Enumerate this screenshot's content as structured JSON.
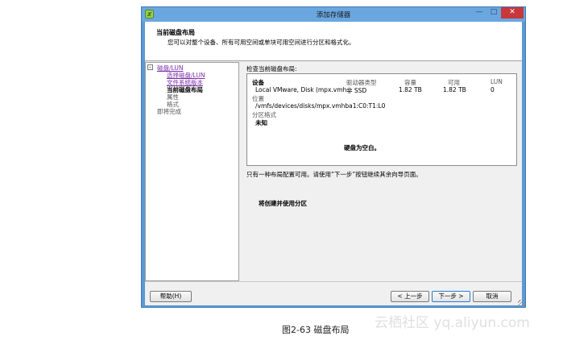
{
  "window": {
    "title": "添加存储器"
  },
  "header": {
    "title": "当前磁盘布局",
    "subtitle": "您可以对整个设备、所有可用空间或单块可用空间进行分区和格式化。"
  },
  "nav": {
    "group": "磁盘/LUN",
    "items": [
      {
        "label": "选择磁盘/LUN",
        "state": "link"
      },
      {
        "label": "文件系统版本",
        "state": "link"
      },
      {
        "label": "当前磁盘布局",
        "state": "current"
      },
      {
        "label": "属性",
        "state": "pending"
      },
      {
        "label": "格式",
        "state": "pending"
      }
    ],
    "finish": "即将完成"
  },
  "review": {
    "label": "检查当前磁盘布局:",
    "columns": [
      "设备",
      "驱动器类型",
      "容量",
      "可用",
      "LUN"
    ],
    "row": {
      "device": "Local VMware, Disk (mpx.vmh...",
      "type": "非 SSD",
      "capacity": "1.82 TB",
      "available": "1.82 TB",
      "lun": "0"
    },
    "location_label": "位置",
    "location_value": "/vmfs/devices/disks/mpx.vmhba1:C0:T1:L0",
    "partition_label": "分区格式",
    "partition_value": "未知",
    "empty_msg": "硬盘为空白。"
  },
  "info": "只有一种布局配置可用。请使用“下一步”按钮继续其余向导页面。",
  "action": "将创建并使用分区",
  "buttons": {
    "help": "帮助(H)",
    "back": "< 上一步",
    "next": "下一步 >",
    "cancel": "取消"
  },
  "caption": "图2-63 磁盘布局",
  "watermark": "云栖社区 yq.aliyun.com"
}
